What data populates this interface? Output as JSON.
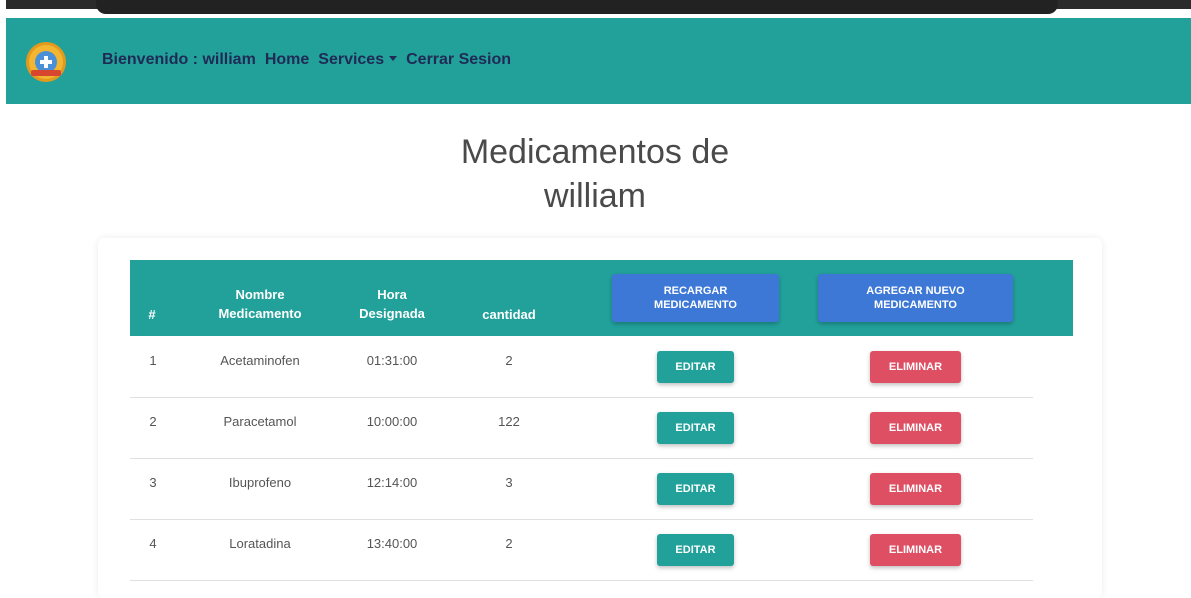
{
  "navbar": {
    "logo": "medical-logo-icon",
    "welcome": "Bienvenido : william",
    "home": "Home",
    "services": "Services",
    "logout": "Cerrar Sesion",
    "background": "#22a19b"
  },
  "page": {
    "title_line1": "Medicamentos de",
    "title_line2": "william"
  },
  "table": {
    "headers": {
      "number": "#",
      "name_line1": "Nombre",
      "name_line2": "Medicamento",
      "time_line1": "Hora",
      "time_line2": "Designada",
      "quantity": "cantidad"
    },
    "reload_button_line1": "RECARGAR",
    "reload_button_line2": "MEDICAMENTO",
    "add_button_line1": "AGREGAR NUEVO",
    "add_button_line2": "MEDICAMENTO",
    "rows": [
      {
        "num": "1",
        "name": "Acetaminofen",
        "time": "01:31:00",
        "qty": "2",
        "edit": "EDITAR",
        "delete": "ELIMINAR"
      },
      {
        "num": "2",
        "name": "Paracetamol",
        "time": "10:00:00",
        "qty": "122",
        "edit": "EDITAR",
        "delete": "ELIMINAR"
      },
      {
        "num": "3",
        "name": "Ibuprofeno",
        "time": "12:14:00",
        "qty": "3",
        "edit": "EDITAR",
        "delete": "ELIMINAR"
      },
      {
        "num": "4",
        "name": "Loratadina",
        "time": "13:40:00",
        "qty": "2",
        "edit": "EDITAR",
        "delete": "ELIMINAR"
      }
    ]
  },
  "colors": {
    "accent": "#22a19b",
    "primary_button": "#3d78d6",
    "danger": "#de4f63",
    "nav_text": "#1f2a55"
  }
}
